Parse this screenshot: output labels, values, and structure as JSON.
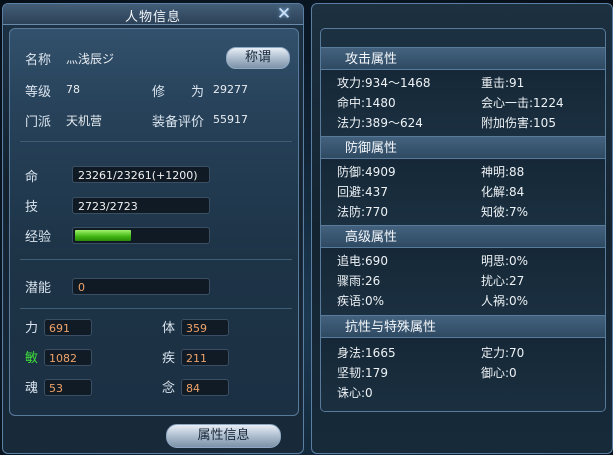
{
  "window": {
    "title": "人物信息"
  },
  "profile": {
    "name_label": "名称",
    "name_value": "灬浅辰ジ",
    "title_button": "称谓",
    "level_label": "等级",
    "level_value": "78",
    "cultivation_label": "修　　为",
    "cultivation_value": "29277",
    "sect_label": "门派",
    "sect_value": "天机营",
    "equip_label": "装备评价",
    "equip_value": "55917"
  },
  "bars": {
    "life_label": "命",
    "life_value": "23261/23261(+1200)",
    "skill_label": "技",
    "skill_value": "2723/2723",
    "exp_label": "经验",
    "exp_fraction": 0.42,
    "potential_label": "潜能",
    "potential_value": "0"
  },
  "stats": [
    {
      "label": "力",
      "value": "691",
      "color": "#d9e4ee"
    },
    {
      "label": "体",
      "value": "359",
      "color": "#d9e4ee"
    },
    {
      "label": "敏",
      "value": "1082",
      "color": "#3ee03a"
    },
    {
      "label": "疾",
      "value": "211",
      "color": "#d9e4ee"
    },
    {
      "label": "魂",
      "value": "53",
      "color": "#d9e4ee"
    },
    {
      "label": "念",
      "value": "84",
      "color": "#d9e4ee"
    }
  ],
  "footer": {
    "attr_button": "属性信息"
  },
  "attack": {
    "header": "攻击属性",
    "rows": [
      [
        "攻力:934～1468",
        "重击:91"
      ],
      [
        "命中:1480",
        "会心一击:1224"
      ],
      [
        "法力:389～624",
        "附加伤害:105"
      ]
    ]
  },
  "defense": {
    "header": "防御属性",
    "rows": [
      [
        "防御:4909",
        "神明:88"
      ],
      [
        "回避:437",
        "化解:84"
      ],
      [
        "法防:770",
        "知彼:7%"
      ]
    ]
  },
  "advanced": {
    "header": "高级属性",
    "rows": [
      [
        "追电:690",
        "明思:0%"
      ],
      [
        "骤雨:26",
        "扰心:27"
      ],
      [
        "疾语:0%",
        "人祸:0%"
      ]
    ]
  },
  "resist": {
    "header": "抗性与特殊属性",
    "rows": [
      [
        "身法:1665",
        "定力:70"
      ],
      [
        "坚韧:179",
        "御心:0"
      ],
      [
        "诛心:0",
        ""
      ]
    ]
  }
}
